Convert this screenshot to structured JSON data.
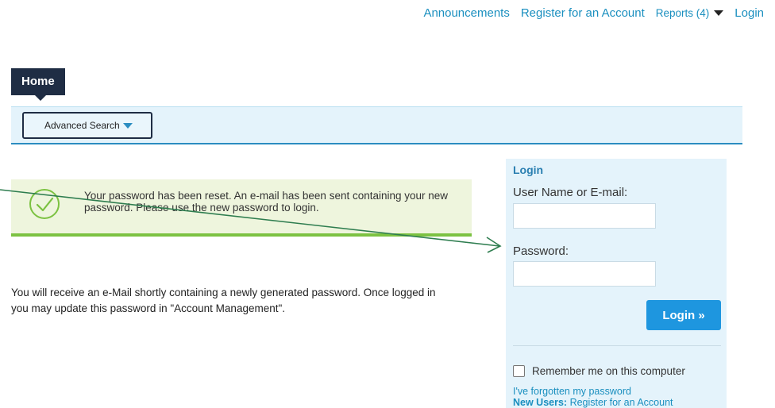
{
  "topnav": {
    "announcements": "Announcements",
    "register": "Register for an Account",
    "reports": "Reports (4)",
    "login": "Login"
  },
  "tabs": {
    "home": "Home"
  },
  "subbar": {
    "advanced_search": "Advanced Search"
  },
  "notice": {
    "message": "Your password has been reset. An e-mail has been sent containing your new password. Please use the new password to login.",
    "icon": "check-circle-icon"
  },
  "info": {
    "text": "You will receive an e-Mail shortly containing a newly generated password. Once logged in you may update this password in \"Account Management\"."
  },
  "login_panel": {
    "title": "Login",
    "username_label": "User Name or E-mail:",
    "username_value": "",
    "password_label": "Password:",
    "password_value": "",
    "login_button": "Login »",
    "remember_label": "Remember me on this computer",
    "forgot_link": "I've forgotten my password",
    "new_users_label": "New Users:",
    "register_link": "Register for an Account"
  },
  "colors": {
    "accent": "#1e96df",
    "nav_dark": "#1f2d44",
    "panel_bg": "#e4f3fb",
    "success_bar": "#7cc242",
    "annotation_arrow": "#2e7d4f"
  }
}
